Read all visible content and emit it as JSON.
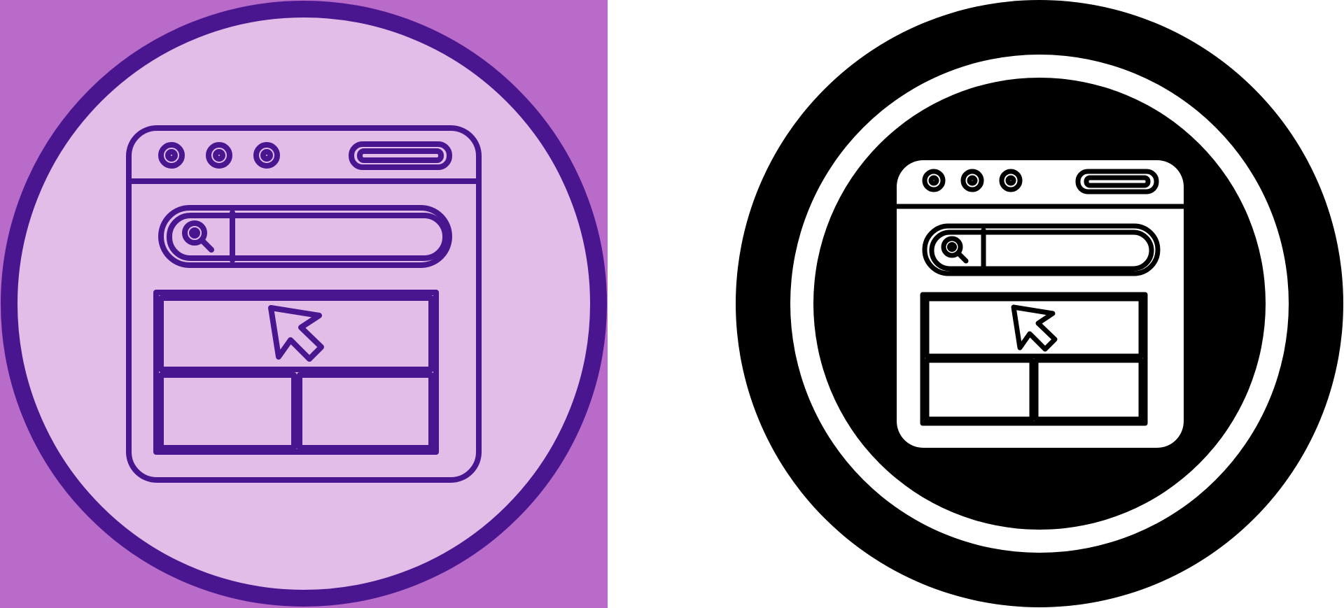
{
  "variants": [
    {
      "name": "purple-line-browser-icon",
      "panel_color": "#b86bc8",
      "circle_fill": "#e1bde7",
      "ring_color": "#4a1690",
      "stroke_color": "#4a1690"
    },
    {
      "name": "black-glyph-browser-icon",
      "panel_color": "#ffffff",
      "outer_circle_color": "#000000",
      "ring_color": "#ffffff",
      "inner_circle_color": "#000000",
      "browser_fill": "#ffffff",
      "stroke_color": "#000000"
    }
  ],
  "icons": [
    "window-dot-icon",
    "search-icon",
    "cursor-icon",
    "address-bar-icon"
  ]
}
